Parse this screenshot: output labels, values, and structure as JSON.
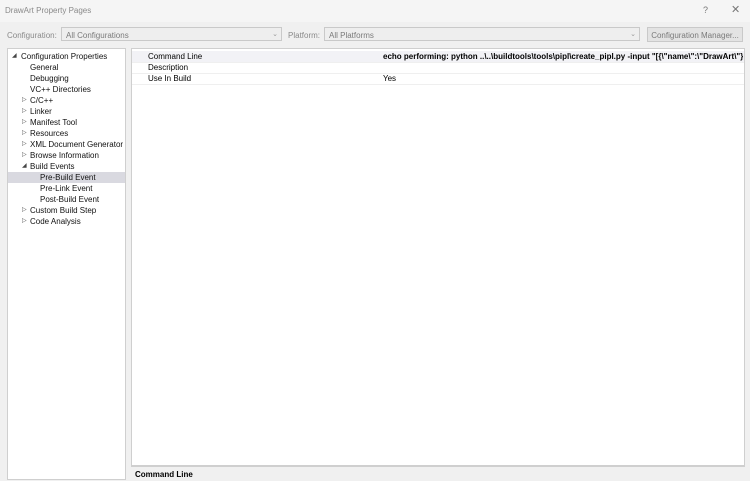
{
  "window": {
    "title": "DrawArt Property Pages",
    "help": "?",
    "close": "✕"
  },
  "config": {
    "configuration_label": "Configuration:",
    "configuration_value": "All Configurations",
    "platform_label": "Platform:",
    "platform_value": "All Platforms",
    "manager_button": "Configuration Manager..."
  },
  "tree": {
    "items": [
      {
        "label": "Configuration Properties",
        "expander": "◢"
      },
      {
        "label": "General",
        "expander": ""
      },
      {
        "label": "Debugging",
        "expander": ""
      },
      {
        "label": "VC++ Directories",
        "expander": ""
      },
      {
        "label": "C/C++",
        "expander": "▷"
      },
      {
        "label": "Linker",
        "expander": "▷"
      },
      {
        "label": "Manifest Tool",
        "expander": "▷"
      },
      {
        "label": "Resources",
        "expander": "▷"
      },
      {
        "label": "XML Document Generator",
        "expander": "▷"
      },
      {
        "label": "Browse Information",
        "expander": "▷"
      },
      {
        "label": "Build Events",
        "expander": "◢"
      },
      {
        "label": "Pre-Build Event",
        "expander": ""
      },
      {
        "label": "Pre-Link Event",
        "expander": ""
      },
      {
        "label": "Post-Build Event",
        "expander": ""
      },
      {
        "label": "Custom Build Step",
        "expander": "▷"
      },
      {
        "label": "Code Analysis",
        "expander": "▷"
      }
    ]
  },
  "grid": {
    "rows": [
      {
        "key": "Command Line",
        "value": "echo   performing: python ..\\..\\buildtools\\tools\\pipl\\create_pipl.py -input \"[{\\\"name\\\":\\\"DrawArt\\\"}]\""
      },
      {
        "key": "Description",
        "value": ""
      },
      {
        "key": "Use In Build",
        "value": "Yes"
      }
    ]
  },
  "description": {
    "title": "Command Line"
  }
}
